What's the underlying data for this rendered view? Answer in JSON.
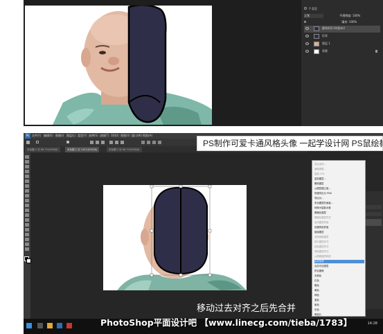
{
  "top_screenshot": {
    "layers_panel": {
      "mode": "正常",
      "opacity_label": "不透明度:",
      "opacity": "100%",
      "fill_label": "填充:",
      "fill": "100%",
      "layers": [
        {
          "name": "圆角矩形1的副本2"
        },
        {
          "name": "形状"
        },
        {
          "name": "图层 1"
        },
        {
          "name": "背景"
        }
      ]
    }
  },
  "photoshop": {
    "logo": "Ps",
    "menu": [
      "文件(F)",
      "编辑(E)",
      "图像(I)",
      "图层(L)",
      "类型(Y)",
      "选择(S)",
      "滤镜(T)",
      "3D(D)",
      "视图(V)",
      "窗口(W)",
      "帮助(H)"
    ],
    "tabs": [
      "未标题-1 @ 66.7%(RGB/8)",
      "未标题-2 @ 100%(RGB/8)",
      "未标题-3 @ 66.7%(RGB/8)"
    ],
    "context_menu": {
      "items": [
        {
          "label": "混合选项...",
          "state": "dim"
        },
        {
          "label": "编辑调整...",
          "state": "dim"
        },
        {
          "label": "复制 CSS",
          "state": "dim"
        },
        {
          "label": "复制图层...",
          "state": "normal"
        },
        {
          "label": "删除图层",
          "state": "normal"
        },
        {
          "label": "从图层建立组...",
          "state": "normal"
        },
        {
          "label": "快速导出为 PNG",
          "state": "normal"
        },
        {
          "label": "导出为...",
          "state": "normal"
        },
        {
          "label": "来自图层的画板...",
          "state": "normal"
        },
        {
          "label": "转换为智能对象",
          "state": "normal"
        },
        {
          "label": "栅格化图层",
          "state": "normal"
        },
        {
          "label": "栅格化图层样式",
          "state": "dim"
        },
        {
          "label": "启用图层蒙版",
          "state": "dim"
        },
        {
          "label": "创建剪贴蒙版",
          "state": "normal"
        },
        {
          "label": "链接图层",
          "state": "normal"
        },
        {
          "label": "选择链接图层",
          "state": "dim"
        },
        {
          "label": "拷贝图层样式",
          "state": "dim"
        },
        {
          "label": "粘贴图层样式",
          "state": "dim"
        },
        {
          "label": "清除图层样式",
          "state": "dim"
        },
        {
          "label": "从隔离图层释放",
          "state": "dim"
        },
        {
          "label": "合并形状",
          "state": "hi"
        },
        {
          "label": "合并可见图层",
          "state": "normal"
        },
        {
          "label": "拼合图像",
          "state": "normal"
        },
        {
          "label": "无颜色",
          "state": "normal"
        },
        {
          "label": "红色",
          "state": "normal"
        },
        {
          "label": "橙色",
          "state": "normal"
        },
        {
          "label": "黄色",
          "state": "normal"
        },
        {
          "label": "绿色",
          "state": "normal"
        },
        {
          "label": "蓝色",
          "state": "normal"
        },
        {
          "label": "紫色",
          "state": "normal"
        },
        {
          "label": "灰色",
          "state": "normal"
        },
        {
          "label": "明信片",
          "state": "normal"
        }
      ]
    },
    "time": "14:28"
  },
  "overlay": {
    "title": "PS制作可爱卡通风格头像 一起学设计网 PS鼠绘教程",
    "caption": "移动过去对齐之后先合并",
    "watermark": "PhotoShop平面设计吧 【www.linecg.com/tieba/1783】"
  },
  "colors": {
    "shape_fill": "#2e2e48",
    "workspace": "#262626",
    "highlight": "#4d8fd8"
  }
}
